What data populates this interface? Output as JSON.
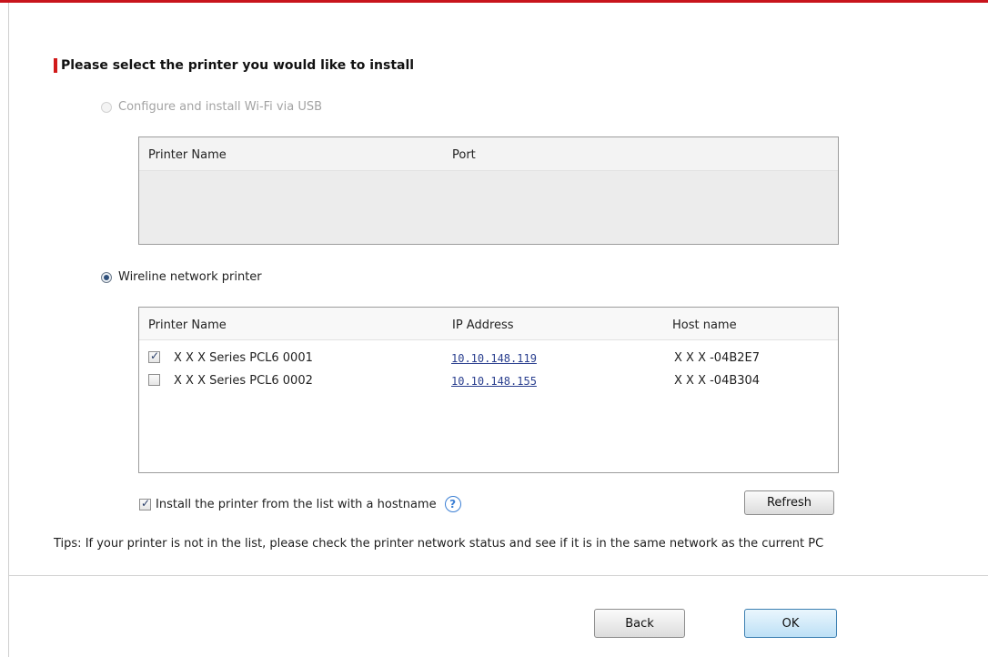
{
  "heading": "Please select the printer you would like to install",
  "usb_option": {
    "label": "Configure and install Wi-Fi via USB",
    "selected": false,
    "enabled": false,
    "columns": [
      "Printer Name",
      "Port"
    ],
    "rows": []
  },
  "network_option": {
    "label": "Wireline network printer",
    "selected": true,
    "columns": [
      "Printer Name",
      "IP Address",
      "Host name"
    ],
    "rows": [
      {
        "checked": true,
        "name": "X X X  Series PCL6 0001",
        "ip": "10.10.148.119",
        "host": "X X X -04B2E7"
      },
      {
        "checked": false,
        "name": "X X X  Series PCL6 0002",
        "ip": "10.10.148.155",
        "host": "X X X -04B304"
      }
    ]
  },
  "install_hostname": {
    "label": "Install the printer from the list with a hostname",
    "checked": true,
    "help_symbol": "?"
  },
  "buttons": {
    "refresh": "Refresh",
    "back": "Back",
    "ok": "OK"
  },
  "tips": "Tips: If your printer is not in the list, please check the printer network status and see if it is in the same network as the current PC",
  "colors": {
    "accent_red": "#c8141c",
    "help_blue": "#3b7fd4",
    "link_blue": "#2a3f8f"
  }
}
